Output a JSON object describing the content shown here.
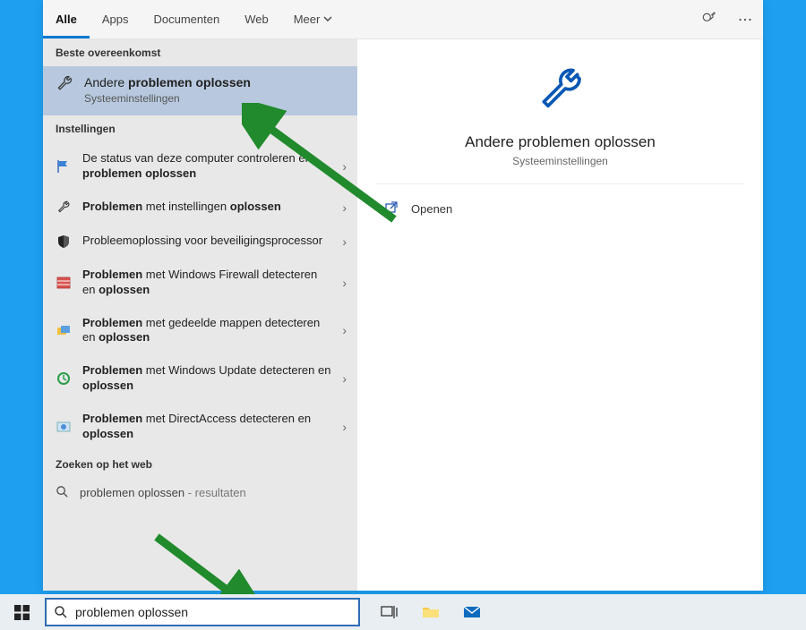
{
  "tabs": {
    "all": "Alle",
    "apps": "Apps",
    "documents": "Documenten",
    "web": "Web",
    "more": "Meer"
  },
  "sections": {
    "best": "Beste overeenkomst",
    "settings": "Instellingen",
    "web": "Zoeken op het web"
  },
  "best": {
    "title_pre": "Andere ",
    "title_bold": "problemen oplossen",
    "subtitle": "Systeeminstellingen"
  },
  "settings_list": [
    {
      "pre": "De status van deze computer controleren en ",
      "bold": "problemen oplossen",
      "post": "",
      "icon": "flag"
    },
    {
      "pre": "",
      "bold": "Problemen",
      "post": " met instellingen ",
      "bold2": "oplossen",
      "icon": "wrench"
    },
    {
      "pre": "Probleemoplossing voor beveiligingsprocessor",
      "bold": "",
      "post": "",
      "icon": "shield"
    },
    {
      "pre": "",
      "bold": "Problemen",
      "post": " met Windows Firewall detecteren en ",
      "bold2": "oplossen",
      "icon": "firewall"
    },
    {
      "pre": "",
      "bold": "Problemen",
      "post": " met gedeelde mappen detecteren en ",
      "bold2": "oplossen",
      "icon": "folders"
    },
    {
      "pre": "",
      "bold": "Problemen",
      "post": " met Windows Update detecteren en ",
      "bold2": "oplossen",
      "icon": "update"
    },
    {
      "pre": "",
      "bold": "Problemen",
      "post": " met DirectAccess detecteren en ",
      "bold2": "oplossen",
      "icon": "direct"
    }
  ],
  "web_result": {
    "query": "problemen oplossen",
    "suffix_visible": "resultaten"
  },
  "preview": {
    "title": "Andere problemen oplossen",
    "subtitle": "Systeeminstellingen",
    "action_open": "Openen"
  },
  "search": {
    "value": "problemen oplossen"
  },
  "colors": {
    "accent": "#0078d4",
    "arrow": "#208a2c"
  }
}
